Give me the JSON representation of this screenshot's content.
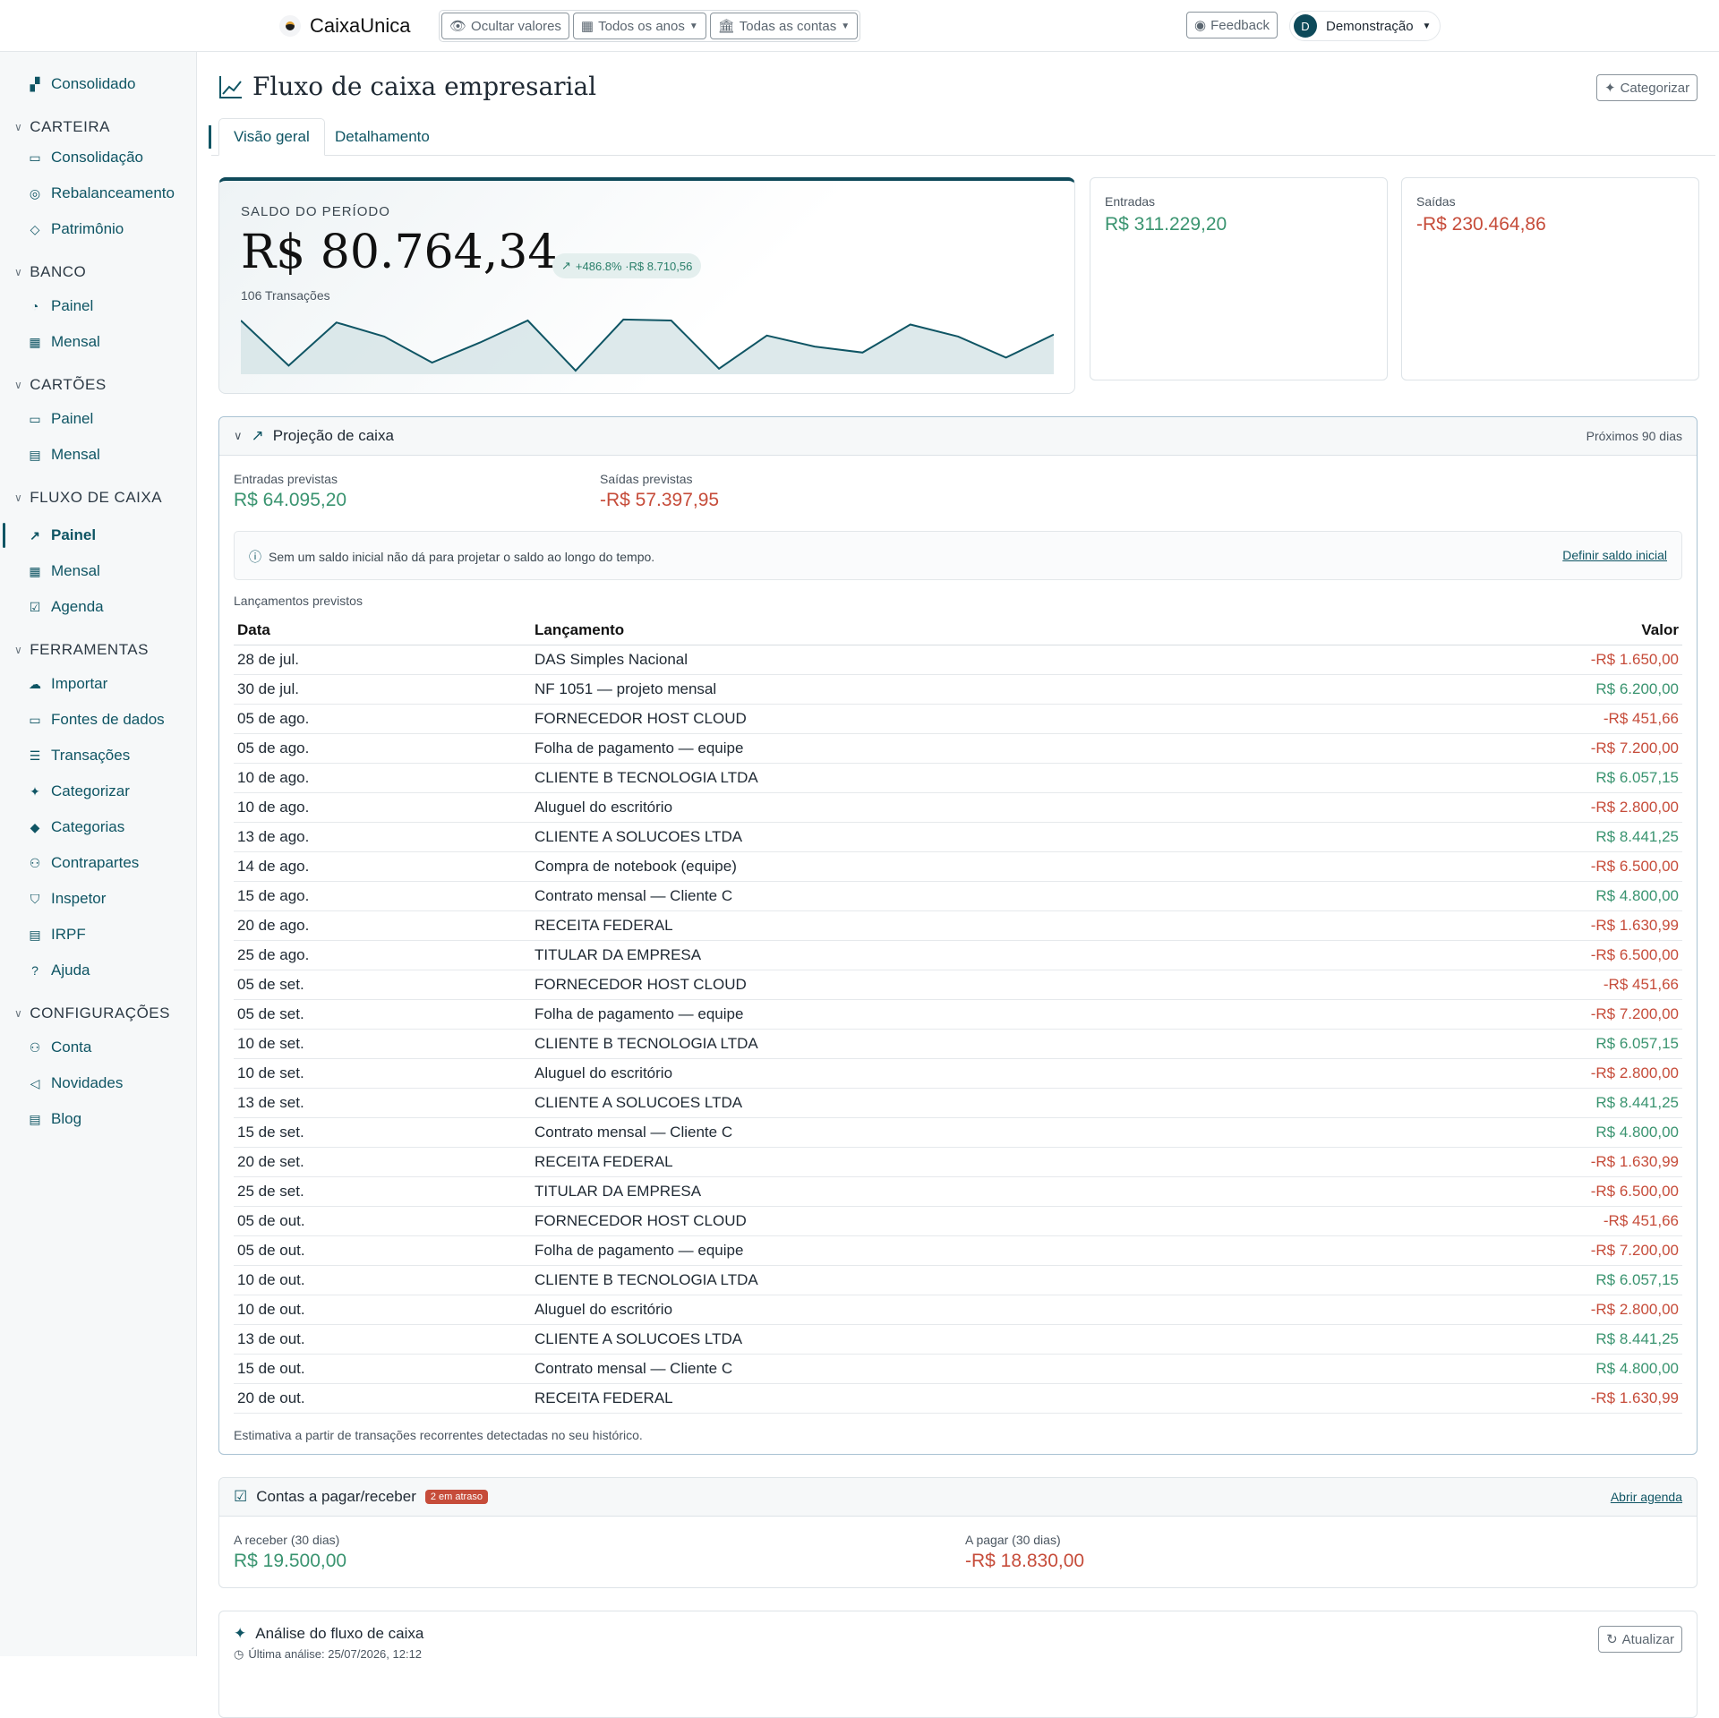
{
  "app": {
    "name": "CaixaUnica"
  },
  "topbar": {
    "hide_values": "Ocultar valores",
    "years": "Todos os anos",
    "accounts": "Todas as contas",
    "feedback": "Feedback",
    "user_initial": "D",
    "user_name": "Demonstração"
  },
  "sidebar": {
    "consolidated": "Consolidado",
    "sections": {
      "carteira": {
        "title": "CARTEIRA",
        "items": [
          "Consolidação",
          "Rebalanceamento",
          "Patrimônio"
        ]
      },
      "banco": {
        "title": "BANCO",
        "items": [
          "Painel",
          "Mensal"
        ]
      },
      "cartoes": {
        "title": "CARTÕES",
        "items": [
          "Painel",
          "Mensal"
        ]
      },
      "fluxo": {
        "title": "FLUXO DE CAIXA",
        "items": [
          "Painel",
          "Mensal",
          "Agenda"
        ]
      },
      "ferramentas": {
        "title": "FERRAMENTAS",
        "items": [
          "Importar",
          "Fontes de dados",
          "Transações",
          "Categorizar",
          "Categorias",
          "Contrapartes",
          "Inspetor",
          "IRPF",
          "Ajuda"
        ]
      },
      "config": {
        "title": "CONFIGURAÇÕES",
        "items": [
          "Conta",
          "Novidades",
          "Blog"
        ]
      }
    }
  },
  "page": {
    "title": "Fluxo de caixa empresarial",
    "categorize_button": "Categorizar",
    "tabs": [
      "Visão geral",
      "Detalhamento"
    ]
  },
  "saldo": {
    "label": "SALDO DO PERÍODO",
    "value": "R$ 80.764,34",
    "change": "+486.8% ·R$ 8.710,56",
    "transactions": "106 Transações",
    "sparkline": [
      0.5,
      0.05,
      0.48,
      0.34,
      0.08,
      0.28,
      0.5,
      0.0,
      0.51,
      0.5,
      0.02,
      0.35,
      0.24,
      0.18,
      0.46,
      0.34,
      0.13,
      0.36
    ]
  },
  "entradas": {
    "label": "Entradas",
    "value": "R$ 311.229,20"
  },
  "saidas": {
    "label": "Saídas",
    "value": "-R$ 230.464,86"
  },
  "projecao": {
    "title": "Projeção de caixa",
    "range": "Próximos 90 dias",
    "entradas_label": "Entradas previstas",
    "entradas_value": "R$ 64.095,20",
    "saidas_label": "Saídas previstas",
    "saidas_value": "-R$ 57.397,95",
    "info": "Sem um saldo inicial não dá para projetar o saldo ao longo do tempo.",
    "info_link": "Definir saldo inicial",
    "table_label": "Lançamentos previstos",
    "columns": [
      "Data",
      "Lançamento",
      "Valor"
    ],
    "rows": [
      [
        "28 de jul.",
        "DAS Simples Nacional",
        "-R$ 1.650,00"
      ],
      [
        "30 de jul.",
        "NF 1051 — projeto mensal",
        "R$ 6.200,00"
      ],
      [
        "05 de ago.",
        "FORNECEDOR HOST CLOUD",
        "-R$ 451,66"
      ],
      [
        "05 de ago.",
        "Folha de pagamento — equipe",
        "-R$ 7.200,00"
      ],
      [
        "10 de ago.",
        "CLIENTE B TECNOLOGIA LTDA",
        "R$ 6.057,15"
      ],
      [
        "10 de ago.",
        "Aluguel do escritório",
        "-R$ 2.800,00"
      ],
      [
        "13 de ago.",
        "CLIENTE A SOLUCOES LTDA",
        "R$ 8.441,25"
      ],
      [
        "14 de ago.",
        "Compra de notebook (equipe)",
        "-R$ 6.500,00"
      ],
      [
        "15 de ago.",
        "Contrato mensal — Cliente C",
        "R$ 4.800,00"
      ],
      [
        "20 de ago.",
        "RECEITA FEDERAL",
        "-R$ 1.630,99"
      ],
      [
        "25 de ago.",
        "TITULAR DA EMPRESA",
        "-R$ 6.500,00"
      ],
      [
        "05 de set.",
        "FORNECEDOR HOST CLOUD",
        "-R$ 451,66"
      ],
      [
        "05 de set.",
        "Folha de pagamento — equipe",
        "-R$ 7.200,00"
      ],
      [
        "10 de set.",
        "CLIENTE B TECNOLOGIA LTDA",
        "R$ 6.057,15"
      ],
      [
        "10 de set.",
        "Aluguel do escritório",
        "-R$ 2.800,00"
      ],
      [
        "13 de set.",
        "CLIENTE A SOLUCOES LTDA",
        "R$ 8.441,25"
      ],
      [
        "15 de set.",
        "Contrato mensal — Cliente C",
        "R$ 4.800,00"
      ],
      [
        "20 de set.",
        "RECEITA FEDERAL",
        "-R$ 1.630,99"
      ],
      [
        "25 de set.",
        "TITULAR DA EMPRESA",
        "-R$ 6.500,00"
      ],
      [
        "05 de out.",
        "FORNECEDOR HOST CLOUD",
        "-R$ 451,66"
      ],
      [
        "05 de out.",
        "Folha de pagamento — equipe",
        "-R$ 7.200,00"
      ],
      [
        "10 de out.",
        "CLIENTE B TECNOLOGIA LTDA",
        "R$ 6.057,15"
      ],
      [
        "10 de out.",
        "Aluguel do escritório",
        "-R$ 2.800,00"
      ],
      [
        "13 de out.",
        "CLIENTE A SOLUCOES LTDA",
        "R$ 8.441,25"
      ],
      [
        "15 de out.",
        "Contrato mensal — Cliente C",
        "R$ 4.800,00"
      ],
      [
        "20 de out.",
        "RECEITA FEDERAL",
        "-R$ 1.630,99"
      ]
    ],
    "footnote": "Estimativa a partir de transações recorrentes detectadas no seu histórico."
  },
  "contas": {
    "title": "Contas a pagar/receber",
    "badge": "2 em atraso",
    "link": "Abrir agenda",
    "receber_label": "A receber (30 dias)",
    "receber_value": "R$ 19.500,00",
    "pagar_label": "A pagar (30 dias)",
    "pagar_value": "-R$ 18.830,00"
  },
  "analise": {
    "title": "Análise do fluxo de caixa",
    "last": "Última análise: 25/07/2026, 12:12",
    "refresh": "Atualizar"
  },
  "colors": {
    "accent": "#0f5564",
    "positive": "#3a9470",
    "negative": "#c64c3a"
  }
}
